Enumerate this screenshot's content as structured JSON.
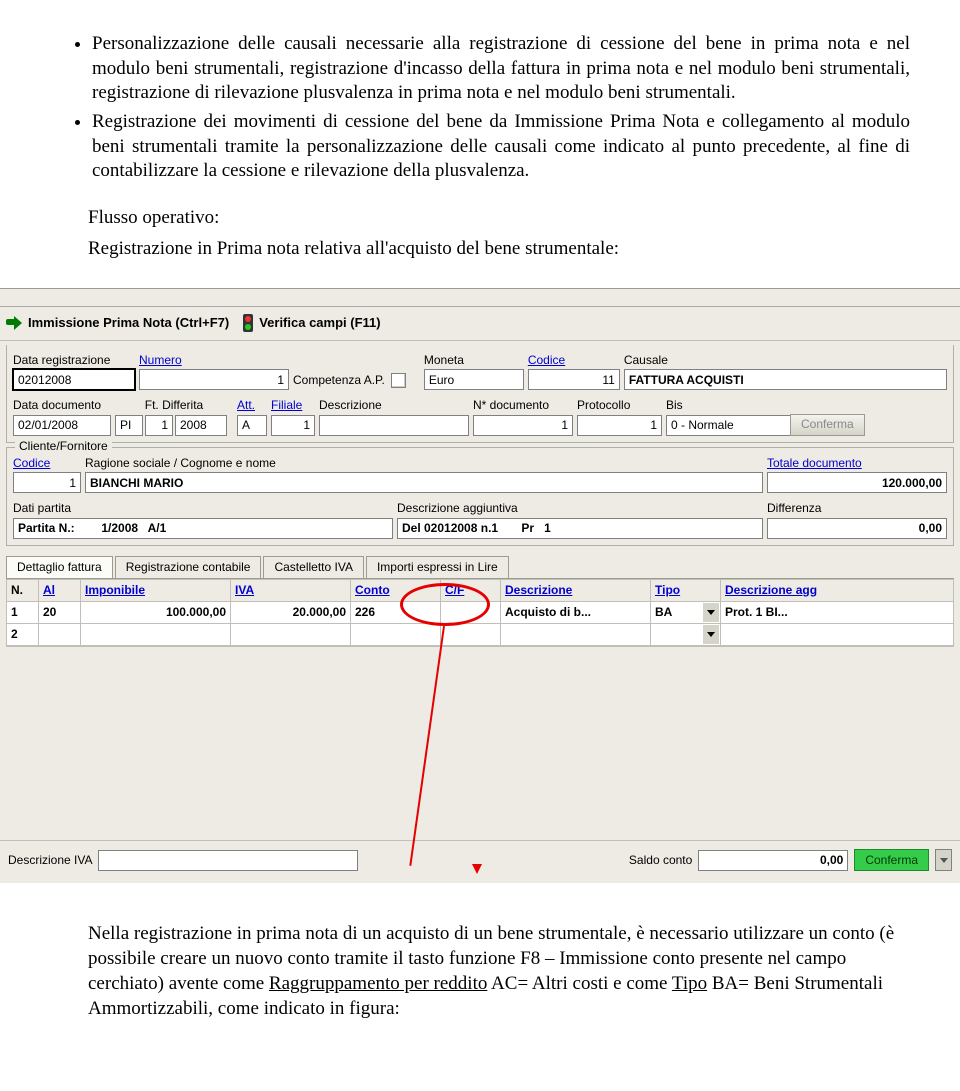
{
  "bullets": [
    "Personalizzazione delle causali necessarie alla registrazione di cessione del bene in prima nota e nel modulo beni strumentali, registrazione d'incasso della fattura in prima nota e nel modulo beni strumentali, registrazione di rilevazione plusvalenza in prima nota e nel modulo beni strumentali.",
    "Registrazione dei movimenti di cessione del bene da Immissione Prima Nota e collegamento al modulo beni strumentali tramite la personalizzazione delle causali come indicato al punto precedente, al fine di contabilizzare la cessione e rilevazione della plusvalenza."
  ],
  "flow_heading_1": "Flusso operativo:",
  "flow_heading_2": "Registrazione in Prima nota relativa all'acquisto del bene strumentale:",
  "toolbar": {
    "menu1": "Immissione Prima Nota (Ctrl+F7)",
    "menu2": "Verifica campi (F11)"
  },
  "labels": {
    "data_reg": "Data registrazione",
    "numero": "Numero",
    "competenza": "Competenza A.P.",
    "moneta": "Moneta",
    "codice": "Codice",
    "causale": "Causale",
    "data_doc": "Data documento",
    "ft_diff": "Ft. Differita",
    "att": "Att.",
    "filiale": "Filiale",
    "descrizione": "Descrizione",
    "n_doc": "N* documento",
    "protocollo": "Protocollo",
    "bis": "Bis",
    "cliente_leg": "Cliente/Fornitore",
    "codice2": "Codice",
    "ragione": "Ragione sociale / Cognome e nome",
    "totale": "Totale documento",
    "dati_partita": "Dati partita",
    "desc_agg": "Descrizione aggiuntiva",
    "differenza": "Differenza",
    "desc_iva": "Descrizione IVA",
    "saldo_conto": "Saldo conto"
  },
  "values": {
    "data_reg": "02012008",
    "numero": "1",
    "moneta": "Euro",
    "codice_caus": "11",
    "causale": "FATTURA ACQUISTI",
    "data_doc": "02/01/2008",
    "ft_diff_pi": "PI",
    "ft_diff_n": "1",
    "ft_diff_y": "2008",
    "att": "A",
    "filiale": "1",
    "n_doc": "1",
    "protocollo": "1",
    "bis": "0 - Normale",
    "cf_codice": "1",
    "cf_nome": "BIANCHI MARIO",
    "totale": "120.000,00",
    "partita": "Partita N.:        1/2008   A/1",
    "desc_agg": "Del 02012008 n.1       Pr   1",
    "differenza": "0,00",
    "saldo_conto": "0,00"
  },
  "tabs": {
    "t1": "Dettaglio fattura",
    "t2": "Registrazione contabile",
    "t3": "Castelletto IVA",
    "t4": "Importi espressi in Lire"
  },
  "table": {
    "headers": {
      "n": "N.",
      "al": "Al",
      "imp": "Imponibile",
      "iva": "IVA",
      "conto": "Conto",
      "cf": "C/F",
      "desc": "Descrizione",
      "tipo": "Tipo",
      "desc2": "Descrizione agg"
    },
    "rows": [
      {
        "n": "1",
        "al": "20",
        "imp": "100.000,00",
        "iva": "20.000,00",
        "conto": "226",
        "cf": "",
        "desc": "Acquisto di b...",
        "tipo": "BA",
        "desc2": "Prot.      1   BI..."
      },
      {
        "n": "2",
        "al": "",
        "imp": "",
        "iva": "",
        "conto": "",
        "cf": "",
        "desc": "",
        "tipo": "",
        "desc2": ""
      }
    ]
  },
  "buttons": {
    "conferma": "Conferma",
    "conferma2": "Conferma"
  },
  "after_text": {
    "part1": "Nella registrazione in prima nota di un acquisto di un bene strumentale, è necessario utilizzare un conto (è possibile creare un nuovo conto tramite il tasto funzione F8 – Immissione conto presente nel campo cerchiato) avente come ",
    "ragg": "Raggruppamento per reddito",
    "part2": " AC= Altri costi e come ",
    "tipo": "Tipo",
    "part3": " BA= Beni Strumentali Ammortizzabili, come indicato in figura:"
  }
}
